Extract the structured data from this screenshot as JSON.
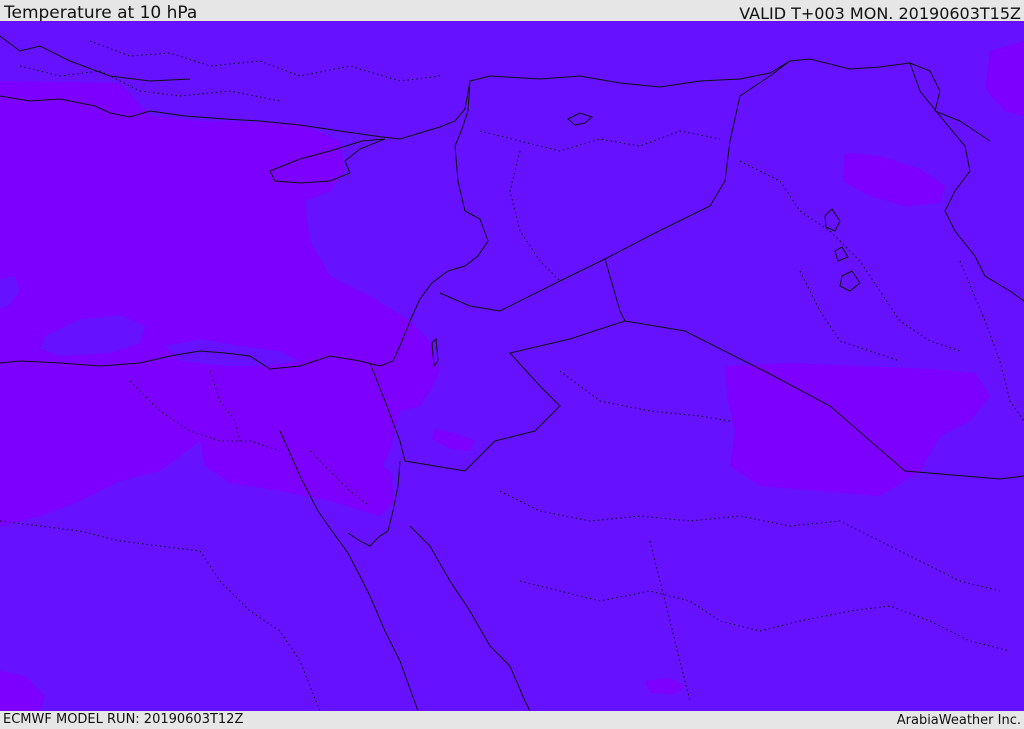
{
  "header": {
    "title": "Temperature at 10 hPa",
    "valid": "VALID T+003 MON. 20190603T15Z"
  },
  "footer": {
    "model_run": "ECMWF MODEL RUN: 20190603T12Z",
    "credit": "ArabiaWeather Inc."
  },
  "map": {
    "field_colors": {
      "base": "#6611ff",
      "warm": "#7d00ff"
    },
    "border_color": "#111111"
  }
}
